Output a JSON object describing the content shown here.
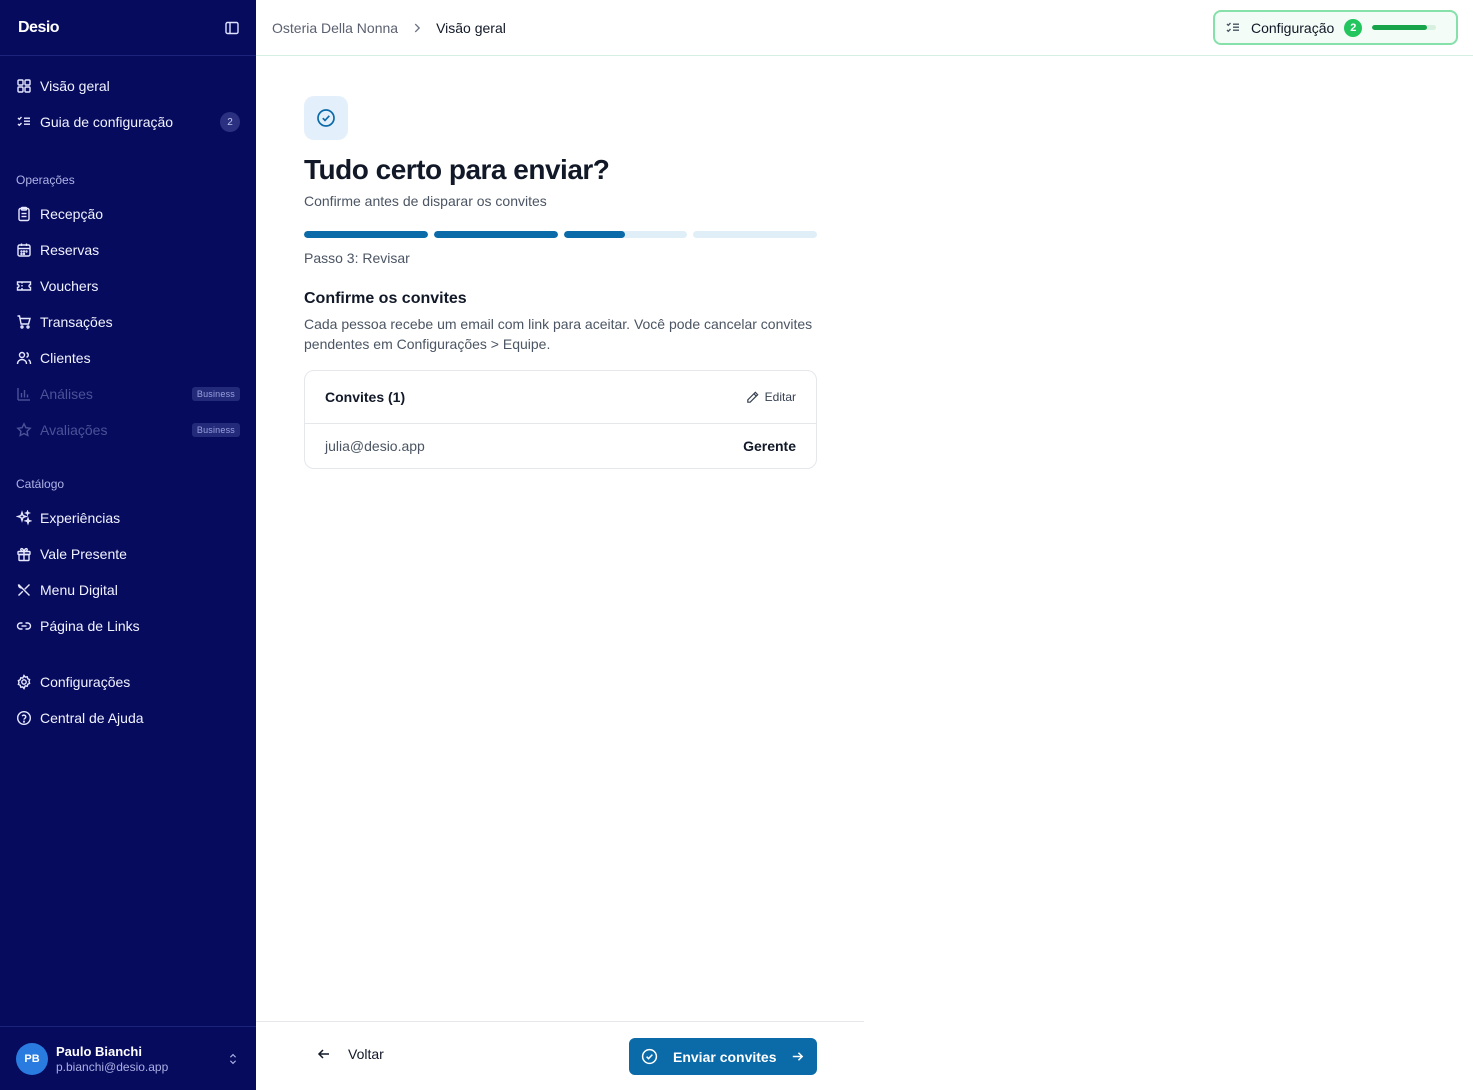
{
  "app": {
    "logo": "Desio"
  },
  "sidebar": {
    "top_items": [
      {
        "label": "Visão geral",
        "icon": "grid-icon"
      },
      {
        "label": "Guia de configuração",
        "icon": "checklist-icon",
        "badge": "2"
      }
    ],
    "sections": {
      "operations": "Operações",
      "catalog": "Catálogo"
    },
    "operations_items": [
      {
        "label": "Recepção",
        "icon": "clipboard-icon"
      },
      {
        "label": "Reservas",
        "icon": "calendar-icon"
      },
      {
        "label": "Vouchers",
        "icon": "ticket-icon"
      },
      {
        "label": "Transações",
        "icon": "cart-icon"
      },
      {
        "label": "Clientes",
        "icon": "users-icon"
      },
      {
        "label": "Análises",
        "icon": "bar-chart-icon",
        "plan": "Business",
        "disabled": true
      },
      {
        "label": "Avaliações",
        "icon": "star-icon",
        "plan": "Business",
        "disabled": true
      }
    ],
    "catalog_items": [
      {
        "label": "Experiências",
        "icon": "sparkles-icon"
      },
      {
        "label": "Vale Presente",
        "icon": "gift-icon"
      },
      {
        "label": "Menu Digital",
        "icon": "utensils-icon"
      },
      {
        "label": "Página de Links",
        "icon": "link-icon"
      }
    ],
    "bottom_items": [
      {
        "label": "Configurações",
        "icon": "gear-icon"
      },
      {
        "label": "Central de Ajuda",
        "icon": "help-circle-icon"
      }
    ],
    "user": {
      "initials": "PB",
      "name": "Paulo Bianchi",
      "email": "p.bianchi@desio.app"
    }
  },
  "header": {
    "breadcrumb": [
      "Osteria Della Nonna",
      "Visão geral"
    ],
    "setup": {
      "label": "Configuração",
      "count": "2",
      "progress": 0.85
    }
  },
  "main": {
    "title": "Tudo certo para enviar?",
    "subtitle": "Confirme antes de disparar os convites",
    "progress_steps": [
      1,
      1,
      0.5,
      0
    ],
    "step_label": "Passo 3: Revisar",
    "section_title": "Confirme os convites",
    "section_desc": "Cada pessoa recebe um email com link para aceitar. Você pode cancelar convites pendentes em Configurações > Equipe.",
    "card": {
      "title": "Convites (1)",
      "edit_label": "Editar",
      "rows": [
        {
          "email": "julia@desio.app",
          "role": "Gerente"
        }
      ]
    }
  },
  "footer": {
    "back_label": "Voltar",
    "send_label": "Enviar convites"
  },
  "colors": {
    "sidebar_bg": "#070b5e",
    "primary": "#0b6aa8",
    "success": "#22c55e"
  }
}
